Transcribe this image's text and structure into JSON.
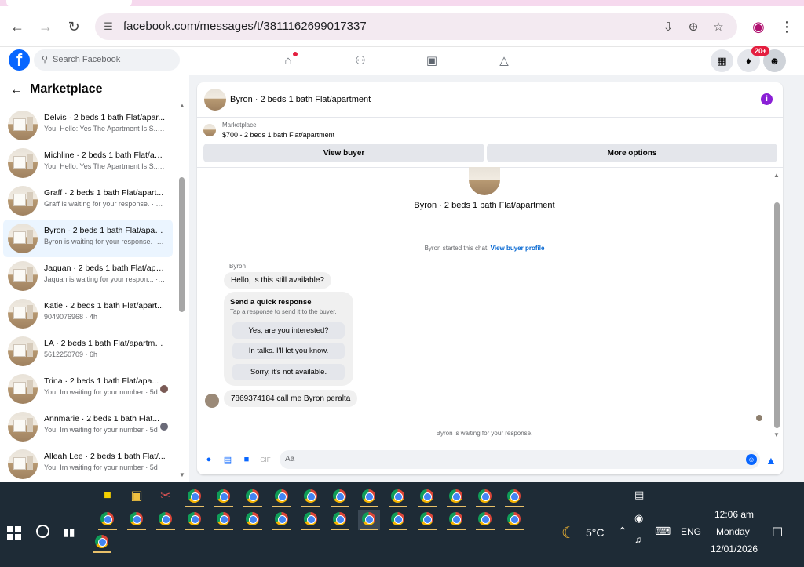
{
  "browser": {
    "url": "facebook.com/messages/t/3811162699017337",
    "icons": [
      "back-icon",
      "forward-icon",
      "reload-icon",
      "site-settings-icon",
      "install-icon",
      "zoom-icon",
      "star-icon",
      "profile-icon",
      "menu-icon"
    ]
  },
  "fb": {
    "search_placeholder": "Search Facebook",
    "notification_badge": "20+"
  },
  "left": {
    "title": "Marketplace",
    "conversations": [
      {
        "title": "Delvis · 2 beds 1 bath Flat/apar...",
        "subtitle": "You: Hello: Yes The Apartment Is S... · 1h",
        "active": false
      },
      {
        "title": "Michline · 2 beds 1 bath Flat/ap...",
        "subtitle": "You: Hello: Yes The Apartment Is S... · 1h",
        "active": false
      },
      {
        "title": "Graff · 2 beds 1 bath Flat/apart...",
        "subtitle": "Graff is waiting for your response. · 18h",
        "active": false
      },
      {
        "title": "Byron · 2 beds 1 bath Flat/apart...",
        "subtitle": "Byron is waiting for your response. · 4h",
        "active": true
      },
      {
        "title": "Jaquan · 2 beds 1 bath Flat/apa...",
        "subtitle": "Jaquan is waiting for your respon... · 4h",
        "active": false
      },
      {
        "title": "Katie · 2 beds 1 bath Flat/apart...",
        "subtitle": "9049076968 · 4h",
        "active": false
      },
      {
        "title": "LA · 2 beds 1 bath Flat/apartme...",
        "subtitle": "5612250709 · 6h",
        "active": false
      },
      {
        "title": "Trina · 2 beds 1 bath Flat/apa...",
        "subtitle": "You: Im waiting for your number · 5d",
        "active": false
      },
      {
        "title": "Annmarie · 2 beds 1 bath Flat...",
        "subtitle": "You: Im waiting for your number · 5d",
        "active": false
      },
      {
        "title": "Alleah Lee · 2 beds 1 bath Flat/...",
        "subtitle": "You: Im waiting for your number · 5d",
        "active": false
      }
    ]
  },
  "chat": {
    "header_title": "Byron · 2 beds 1 bath Flat/apartment",
    "marketplace_label": "Marketplace",
    "listing": "$700 - 2 beds 1 bath Flat/apartment",
    "view_buyer": "View buyer",
    "more_options": "More options",
    "center_title": "Byron · 2 beds 1 bath Flat/apartment",
    "started_text": "Byron started this chat.",
    "view_profile": "View buyer profile",
    "sender": "Byron",
    "msg1": "Hello, is this still available?",
    "quick_title": "Send a quick response",
    "quick_sub": "Tap a response to send it to the buyer.",
    "quick_options": [
      "Yes, are you interested?",
      "In talks. I'll let you know.",
      "Sorry, it's not available."
    ],
    "msg2": "7869374184 call me Byron peralta",
    "waiting": "Byron is waiting for your response.",
    "composer_placeholder": "Aa"
  },
  "taskbar": {
    "weather": "5°C",
    "lang": "ENG",
    "time": "12:06 am",
    "day": "Monday",
    "date": "12/01/2026"
  }
}
